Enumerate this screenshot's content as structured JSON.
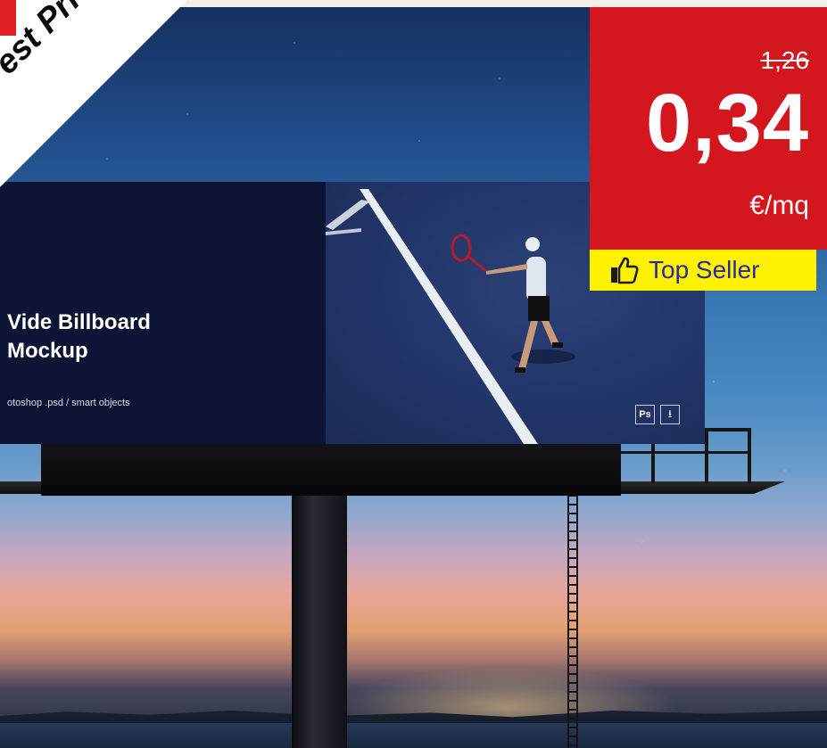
{
  "banner": {
    "best_price": "est Price"
  },
  "price": {
    "old": "1,26",
    "new": "0,34",
    "unit": "€/mq"
  },
  "badge": {
    "top_seller": "Top Seller",
    "icon": "thumbs-up-icon"
  },
  "billboard": {
    "title": "Vide Billboard\nMockup",
    "subtitle": "otoshop .psd / smart objects",
    "ps_label": "Ps",
    "download_icon": "⭳"
  },
  "colors": {
    "red": "#d4161f",
    "yellow": "#fff200",
    "seller_text": "#2a2a9c"
  }
}
